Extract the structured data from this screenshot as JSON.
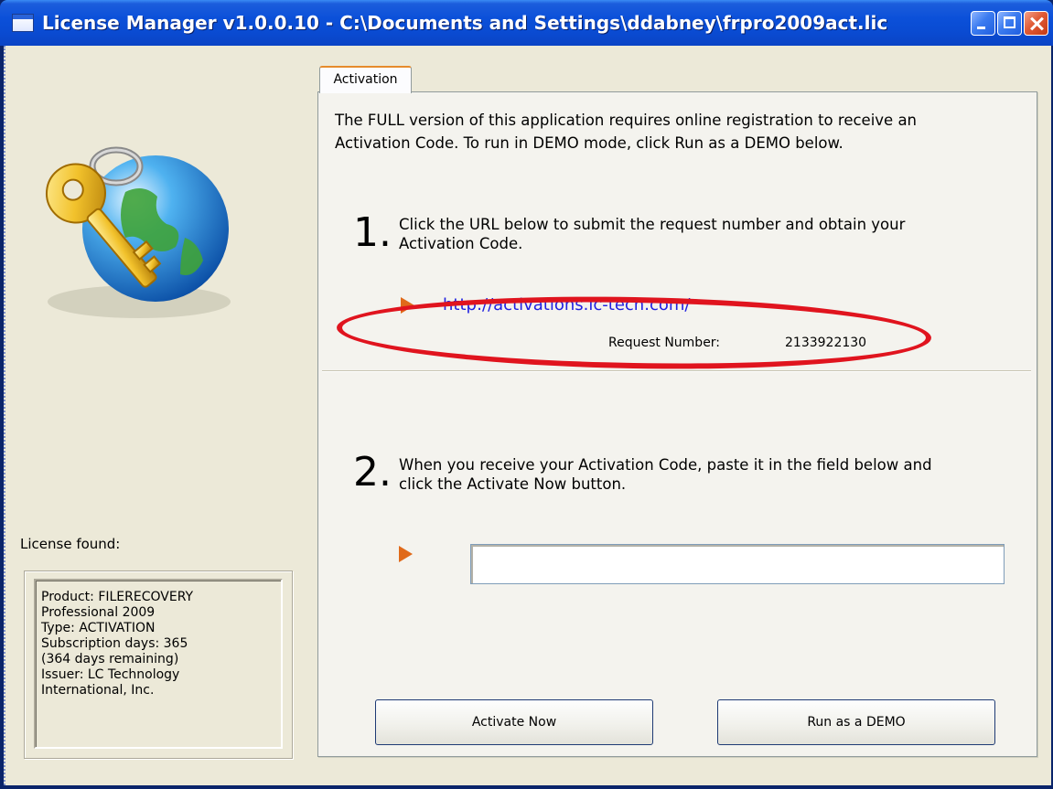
{
  "window": {
    "title": "License Manager v1.0.0.10 - C:\\Documents and Settings\\ddabney\\frpro2009act.lic"
  },
  "left": {
    "license_label": "License found:",
    "license_lines": [
      "Product: FILERECOVERY",
      "Professional 2009",
      "Type: ACTIVATION",
      "Subscription days: 365",
      "(364 days remaining)",
      "Issuer: LC Technology",
      "International, Inc."
    ]
  },
  "tabs": [
    {
      "label": "Activation"
    }
  ],
  "activation": {
    "intro_line1": "The FULL version of this application requires online registration to receive an",
    "intro_line2": "Activation Code. To run in DEMO mode, click Run as a DEMO below.",
    "step1_number": "1.",
    "step1_line1": "Click the URL below to submit the request number and obtain your",
    "step1_line2": "Activation Code.",
    "url": "http://activations.lc-tech.com/",
    "request_label": "Request Number:",
    "request_value": "2133922130",
    "step2_number": "2.",
    "step2_line1": "When you receive your Activation Code, paste it in the field below and",
    "step2_line2": "click the Activate Now button.",
    "code_value": ""
  },
  "buttons": {
    "activate": "Activate Now",
    "demo": "Run as a DEMO"
  },
  "colors": {
    "highlight_ellipse": "#e0141e",
    "link": "#2020e0",
    "arrow": "#e06a1a"
  }
}
